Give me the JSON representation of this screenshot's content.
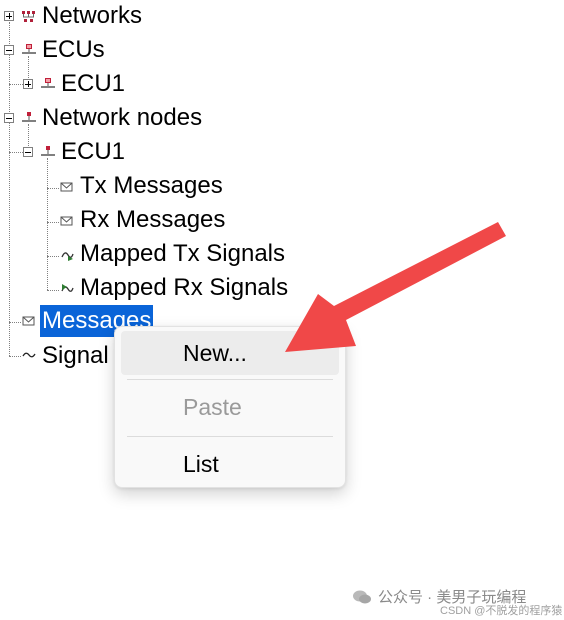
{
  "tree": {
    "networks": {
      "label": "Networks",
      "icon": "network-icon"
    },
    "ecus": {
      "label": "ECUs",
      "icon": "ecu-icon"
    },
    "ecus_child": {
      "label": "ECU1",
      "icon": "ecu-icon"
    },
    "network_nodes": {
      "label": "Network nodes",
      "icon": "node-icon"
    },
    "node_ecu1": {
      "label": "ECU1",
      "icon": "node-icon"
    },
    "tx_messages": {
      "label": "Tx Messages",
      "icon": "envelope-icon"
    },
    "rx_messages": {
      "label": "Rx Messages",
      "icon": "envelope-icon"
    },
    "mapped_tx": {
      "label": "Mapped Tx Signals",
      "icon": "mapped-tx-signal-icon"
    },
    "mapped_rx": {
      "label": "Mapped Rx Signals",
      "icon": "mapped-rx-signal-icon"
    },
    "messages": {
      "label": "Messages",
      "icon": "envelope-icon",
      "selected": true
    },
    "signals": {
      "label": "Signal",
      "icon": "signal-wave-icon"
    }
  },
  "context_menu": {
    "items": [
      {
        "label": "New...",
        "state": "hover"
      },
      {
        "label": "Paste",
        "state": "disabled"
      },
      {
        "label": "List",
        "state": "normal"
      }
    ]
  },
  "annotation": {
    "arrow_color": "#f04848"
  },
  "watermark": {
    "text": "公众号 · 美男子玩编程",
    "subtext": "CSDN @不脱发的程序猿"
  },
  "colors": {
    "selection": "#0a64d8"
  }
}
